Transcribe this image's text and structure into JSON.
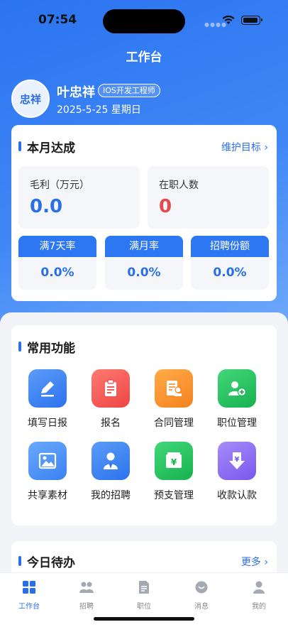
{
  "status_bar": {
    "time": "07:54"
  },
  "nav": {
    "title": "工作台"
  },
  "profile": {
    "avatar_text": "忠祥",
    "name": "叶忠祥",
    "role": "IOS开发工程师",
    "date": "2025-5-25 星期日"
  },
  "monthly": {
    "title": "本月达成",
    "link": "维护目标 ›",
    "metrics": [
      {
        "label": "毛利（万元）",
        "value": "0.0",
        "color": "#2b6fe6"
      },
      {
        "label": "在职人数",
        "value": "0",
        "color": "#e5484d"
      }
    ],
    "rates": [
      {
        "label": "满7天率",
        "value": "0.0%"
      },
      {
        "label": "满月率",
        "value": "0.0%"
      },
      {
        "label": "招聘份额",
        "value": "0.0%"
      }
    ]
  },
  "functions": {
    "title": "常用功能",
    "items": [
      {
        "label": "填写日报",
        "icon": "edit-icon",
        "color": "#3d86f5"
      },
      {
        "label": "报名",
        "icon": "clipboard-icon",
        "color": "#f05a5a"
      },
      {
        "label": "合同管理",
        "icon": "contract-icon",
        "color": "#f7922e"
      },
      {
        "label": "职位管理",
        "icon": "add-user-icon",
        "color": "#23c160"
      },
      {
        "label": "共享素材",
        "icon": "image-icon",
        "color": "#4e94f7"
      },
      {
        "label": "我的招聘",
        "icon": "person-tie-icon",
        "color": "#3d86f5"
      },
      {
        "label": "预支管理",
        "icon": "money-envelope-icon",
        "color": "#23c160"
      },
      {
        "label": "收款认款",
        "icon": "receive-money-icon",
        "color": "#8b6cf2"
      }
    ]
  },
  "todo": {
    "title": "今日待办",
    "link": "更多 ›"
  },
  "tabs": [
    {
      "label": "工作台",
      "icon": "grid-icon",
      "active": true
    },
    {
      "label": "招聘",
      "icon": "people-icon",
      "active": false
    },
    {
      "label": "职位",
      "icon": "document-icon",
      "active": false
    },
    {
      "label": "消息",
      "icon": "chat-icon",
      "active": false
    },
    {
      "label": "我的",
      "icon": "user-icon",
      "active": false
    }
  ]
}
